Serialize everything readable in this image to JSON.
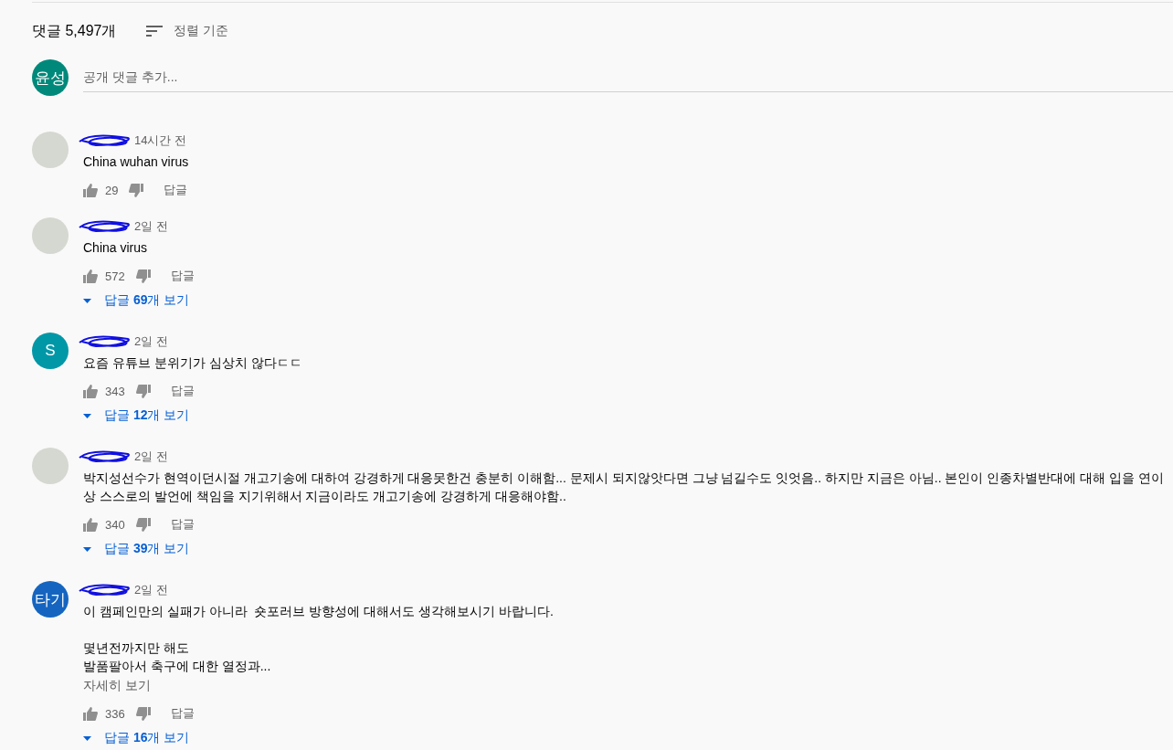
{
  "header": {
    "count": "댓글 5,497개",
    "sort_label": "정렬 기준"
  },
  "add_comment": {
    "avatar": {
      "text": "윤성",
      "color": "#00897b"
    },
    "placeholder": "공개 댓글 추가..."
  },
  "comments": [
    {
      "avatar": {
        "kind": "photo"
      },
      "author_redacted": true,
      "time": "14시간 전",
      "paragraphs": [
        [
          "China wuhan virus"
        ]
      ],
      "likes": "29",
      "reply_label": "답글"
    },
    {
      "avatar": {
        "kind": "photo"
      },
      "author_redacted": true,
      "time": "2일 전",
      "paragraphs": [
        [
          "China virus"
        ]
      ],
      "likes": "572",
      "reply_label": "답글",
      "replies": "답글 **69**개 보기"
    },
    {
      "avatar": {
        "kind": "letter",
        "text": "S",
        "color": "#0097a7"
      },
      "author_redacted": true,
      "time": "2일 전",
      "paragraphs": [
        [
          "요즘 유튜브 분위기가 심상치 않다ㄷㄷ"
        ]
      ],
      "likes": "343",
      "reply_label": "답글",
      "replies": "답글 **12**개 보기"
    },
    {
      "avatar": {
        "kind": "photo"
      },
      "author_redacted": true,
      "time": "2일 전",
      "paragraphs": [
        [
          "박지성선수가 현역이던시절 개고기송에 대하여 강경하게 대응못한건 충분히 이해함... 문제시 되지않앗다면 그냥 넘길수도 잇엇음.. 하지만 지금은 아님.. 본인이 인종차별반대에 대해 입을 연이",
          "상 스스로의 발언에 책임을 지기위해서 지금이라도 개고기송에 강경하게 대응해야함.."
        ]
      ],
      "likes": "340",
      "reply_label": "답글",
      "replies": "답글 **39**개 보기"
    },
    {
      "avatar": {
        "kind": "letter",
        "text": "타기",
        "color": "#1565c0"
      },
      "author_redacted": true,
      "time": "2일 전",
      "paragraphs": [
        [
          "이 캠페인만의 실패가 아니라  숏포러브 방향성에 대해서도 생각해보시기 바랍니다."
        ],
        [
          "몇년전까지만 해도",
          "발품팔아서 축구에 대한 열정과..."
        ]
      ],
      "more": "자세히 보기",
      "likes": "336",
      "reply_label": "답글",
      "replies": "답글 **16**개 보기"
    }
  ]
}
